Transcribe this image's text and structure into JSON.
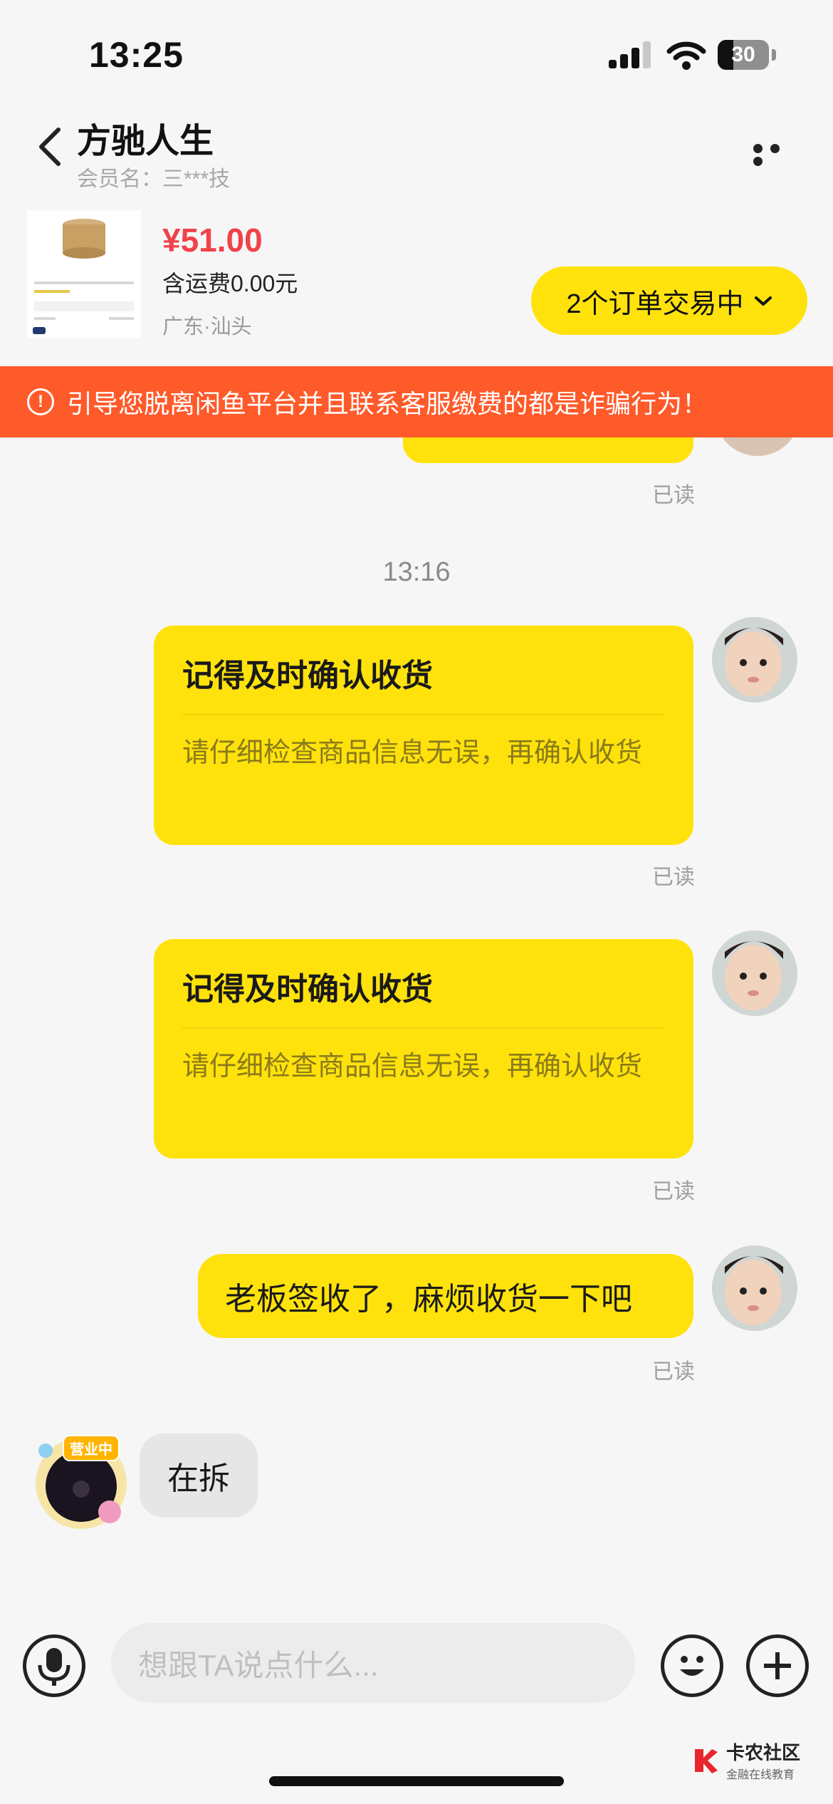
{
  "status_bar": {
    "time": "13:25",
    "battery": "30",
    "battery_level": 0.3
  },
  "header": {
    "title": "方驰人生",
    "subtitle": "会员名：三***技"
  },
  "product": {
    "price": "¥51.00",
    "shipping": "含运费0.00元",
    "location": "广东·汕头",
    "order_button": "2个订单交易中"
  },
  "banner": {
    "text": "引导您脱离闲鱼平台并且联系客服缴费的都是诈骗行为！"
  },
  "messages": {
    "read_label": "已读",
    "time": "13:16",
    "card1": {
      "title": "记得及时确认收货",
      "body": "请仔细检查商品信息无误，再确认收货"
    },
    "card2": {
      "title": "记得及时确认收货",
      "body": "请仔细检查商品信息无误，再确认收货"
    },
    "text1": "老板签收了，麻烦收货一下吧",
    "reply": "在拆",
    "badge": "营业中"
  },
  "input_bar": {
    "placeholder": "想跟TA说点什么..."
  },
  "watermark": {
    "title": "卡农社区",
    "subtitle": "金融在线教育"
  },
  "colors": {
    "accent": "#ffe20c",
    "price": "#f0424a",
    "banner": "#ff5a2a"
  }
}
